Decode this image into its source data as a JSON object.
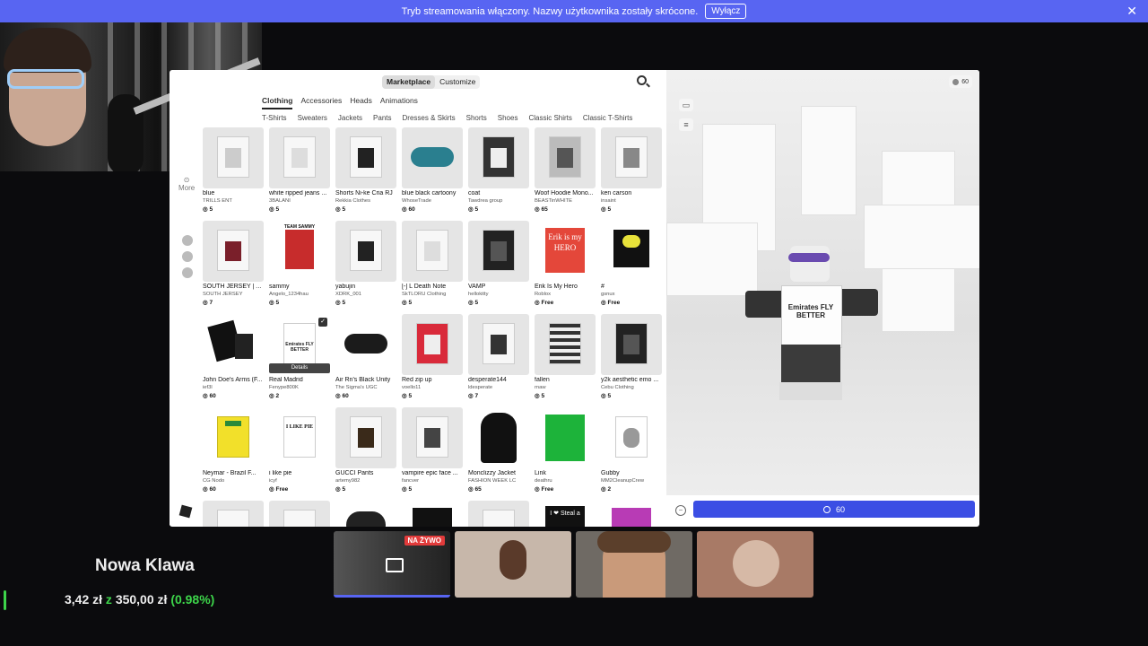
{
  "banner": {
    "message": "Tryb streamowania włączony. Nazwy użytkownika zostały skrócone.",
    "button": "Wyłącz"
  },
  "header": {
    "segments": [
      "Marketplace",
      "Customize"
    ],
    "tabs": [
      "Clothing",
      "Accessories",
      "Heads",
      "Animations"
    ],
    "subcategories": [
      "T-Shirts",
      "Sweaters",
      "Jackets",
      "Pants",
      "Dresses & Skirts",
      "Shorts",
      "Shoes",
      "Classic Shirts",
      "Classic T-Shirts"
    ]
  },
  "leftrail": {
    "more": "More"
  },
  "coins": {
    "balance": "60"
  },
  "items": [
    {
      "name": "blue",
      "creator": "TRILLS ENT",
      "price": "5"
    },
    {
      "name": "white ripped jeans ...",
      "creator": "3BALANI",
      "price": "5"
    },
    {
      "name": "Shorts Ni-ke Cria RJ",
      "creator": "Rekkia Clothes",
      "price": "5"
    },
    {
      "name": "blue black cartoony",
      "creator": "WhoseTrade",
      "price": "60"
    },
    {
      "name": "coat",
      "creator": "Tawdrea group",
      "price": "5"
    },
    {
      "name": "Woof Hoodie Mono...",
      "creator": "BEASTinWHITE",
      "price": "65"
    },
    {
      "name": "ken carson",
      "creator": "insaint",
      "price": "5"
    },
    {
      "name": "SOUTH JERSEY | Ar...",
      "creator": "SOUTH JERSEY",
      "price": "7"
    },
    {
      "name": "sammy",
      "creator": "Angelo_1234hau",
      "price": "5"
    },
    {
      "name": "yabujin",
      "creator": "XDRK_001",
      "price": "5"
    },
    {
      "name": "[-] L Death Note",
      "creator": "SkTLORU Clothing",
      "price": "5"
    },
    {
      "name": "VAMP",
      "creator": "hellokitty",
      "price": "5"
    },
    {
      "name": "Erik Is My Hero",
      "creator": "Roblox",
      "price": "Free"
    },
    {
      "name": "#",
      "creator": "gsnux",
      "price": "Free"
    },
    {
      "name": "John Doe's Arms (F...",
      "creator": "ief3l",
      "price": "60"
    },
    {
      "name": "Real Madrid",
      "creator": "Fenype800K",
      "price": "2"
    },
    {
      "name": "Air Rn's Black Unity",
      "creator": "The Sigma's UGC",
      "price": "60"
    },
    {
      "name": "Red zip up",
      "creator": "voello11",
      "price": "5"
    },
    {
      "name": "desperate144",
      "creator": "ldesperate",
      "price": "7"
    },
    {
      "name": "fallen",
      "creator": "rnaw",
      "price": "5"
    },
    {
      "name": "y2k aesthetic emo ...",
      "creator": "Cebu Clothing",
      "price": "5"
    },
    {
      "name": "Neymar - Brazil F...",
      "creator": "CG Nodo",
      "price": "60"
    },
    {
      "name": "i like pie",
      "creator": "icyf",
      "price": "Free"
    },
    {
      "name": "GUCCI Pants",
      "creator": "artemy982",
      "price": "5"
    },
    {
      "name": "vampire epic face ...",
      "creator": "fancver",
      "price": "5"
    },
    {
      "name": "Monclizzy Jacket",
      "creator": "FASHION WEEK LC",
      "price": "65"
    },
    {
      "name": "Link",
      "creator": "deathru",
      "price": "Free"
    },
    {
      "name": "Gubby",
      "creator": "MM2CleanupCrew",
      "price": "2"
    }
  ],
  "thumb_texts": {
    "sammy": "TEAM SAMMY",
    "erik": "Erik is my HERO",
    "realmadrid": "Emirates FLY BETTER",
    "pie": "I LIKE PIE",
    "steal": "I ❤ Steal a",
    "details": "Details"
  },
  "avatar": {
    "shirt_text": "Emirates FLY BETTER"
  },
  "buy": {
    "price": "60"
  },
  "goal": {
    "title": "Nowa Klawa",
    "current": "3,42 zł",
    "sep": "z",
    "target": "350,00 zł",
    "percent": "(0.98%)"
  },
  "tiles": {
    "live": "NA ŻYWO"
  },
  "colors": {
    "banner": "#5865f2",
    "buy": "#3b4ee4",
    "goal_green": "#3dd44a"
  }
}
